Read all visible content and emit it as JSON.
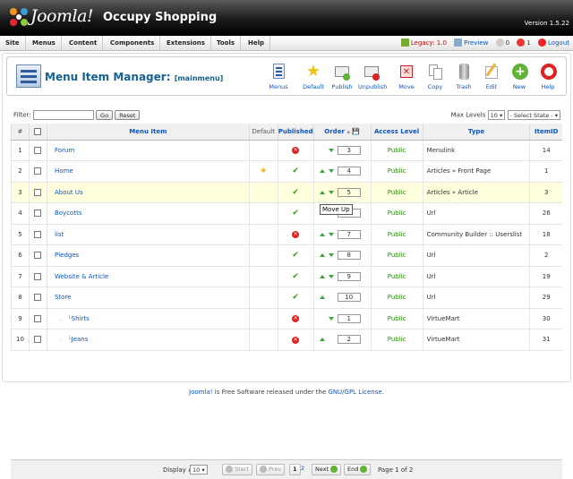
{
  "header": {
    "brand": "Joomla!",
    "site_name": "Occupy Shopping",
    "version": "Version 1.5.22"
  },
  "menu": [
    "Site",
    "Menus",
    "Content",
    "Components",
    "Extensions",
    "Tools",
    "Help"
  ],
  "status": {
    "legacy": "Legacy: 1.0",
    "preview": "Preview",
    "messages": "0",
    "users": "1",
    "logout": "Logout"
  },
  "page": {
    "title": "Menu Item Manager:",
    "subtitle": "[mainmenu]"
  },
  "toolbar": [
    {
      "label": "Menus",
      "icon": "menus-icon"
    },
    {
      "label": "Default",
      "icon": "star-icon"
    },
    {
      "label": "Publish",
      "icon": "publish-icon"
    },
    {
      "label": "Unpublish",
      "icon": "unpublish-icon"
    },
    {
      "label": "Move",
      "icon": "move-icon"
    },
    {
      "label": "Copy",
      "icon": "copy-icon"
    },
    {
      "label": "Trash",
      "icon": "trash-icon"
    },
    {
      "label": "Edit",
      "icon": "edit-icon"
    },
    {
      "label": "New",
      "icon": "new-icon"
    },
    {
      "label": "Help",
      "icon": "help-icon"
    }
  ],
  "filter": {
    "label": "Filter:",
    "value": "",
    "go": "Go",
    "reset": "Reset",
    "max_levels_label": "Max Levels",
    "max_levels": "10",
    "state": "- Select State -"
  },
  "columns": {
    "num": "#",
    "item": "Menu Item",
    "default": "Default",
    "published": "Published",
    "order": "Order",
    "access": "Access Level",
    "type": "Type",
    "id": "ItemID"
  },
  "rows": [
    {
      "num": "1",
      "name": "Forum",
      "default": false,
      "published": false,
      "order": "3",
      "access": "Public",
      "type": "Menulink",
      "id": "14",
      "up": false,
      "down": true
    },
    {
      "num": "2",
      "name": "Home",
      "default": true,
      "published": true,
      "order": "4",
      "access": "Public",
      "type": "Articles » Front Page",
      "id": "1",
      "up": true,
      "down": true
    },
    {
      "num": "3",
      "name": "About Us",
      "default": false,
      "published": true,
      "order": "5",
      "access": "Public",
      "type": "Articles » Article",
      "id": "3",
      "up": true,
      "down": true
    },
    {
      "num": "4",
      "name": "Boycotts",
      "default": false,
      "published": true,
      "order": "6",
      "access": "Public",
      "type": "Url",
      "id": "26",
      "up": true,
      "down": true
    },
    {
      "num": "5",
      "name": "list",
      "default": false,
      "published": false,
      "order": "7",
      "access": "Public",
      "type": "Community Builder :: Userslist",
      "id": "18",
      "up": true,
      "down": true
    },
    {
      "num": "6",
      "name": "Pledges",
      "default": false,
      "published": true,
      "order": "8",
      "access": "Public",
      "type": "Url",
      "id": "2",
      "up": true,
      "down": true
    },
    {
      "num": "7",
      "name": "Website & Article",
      "default": false,
      "published": true,
      "order": "9",
      "access": "Public",
      "type": "Url",
      "id": "19",
      "up": true,
      "down": true
    },
    {
      "num": "8",
      "name": "Store",
      "default": false,
      "published": true,
      "order": "10",
      "access": "Public",
      "type": "Url",
      "id": "29",
      "up": true,
      "down": false
    },
    {
      "num": "9",
      "name": "Shirts",
      "default": false,
      "published": false,
      "order": "1",
      "access": "Public",
      "type": "VirtueMart",
      "id": "30",
      "up": false,
      "down": true,
      "child": true
    },
    {
      "num": "10",
      "name": "Jeans",
      "default": false,
      "published": false,
      "order": "2",
      "access": "Public",
      "type": "VirtueMart",
      "id": "31",
      "up": true,
      "down": false,
      "child": true
    }
  ],
  "tooltip": "Move Up",
  "pagination": {
    "display_label": "Display #",
    "display": "10",
    "start": "Start",
    "prev": "Prev",
    "page1": "1",
    "page2": "2",
    "next": "Next",
    "end": "End",
    "info": "Page 1 of 2"
  },
  "footer": {
    "joomla": "Joomla!",
    "text1": " is Free Software released under the ",
    "license": "GNU/GPL License",
    "text2": "."
  }
}
